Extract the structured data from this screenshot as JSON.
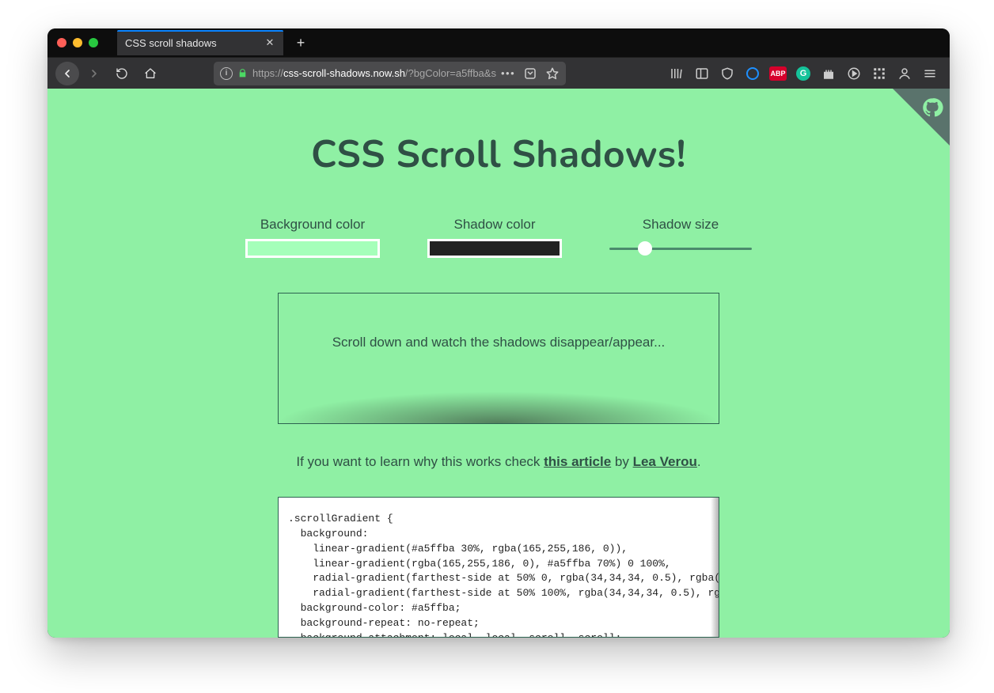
{
  "colors": {
    "page_bg": "#8ff0a4",
    "accent_text": "#2f5045",
    "bg_color_value": "#a5ffba",
    "shadow_color_value": "#222222"
  },
  "window": {
    "close": "",
    "minimize": "",
    "maximize": ""
  },
  "tab": {
    "title": "CSS scroll shadows",
    "close": "✕"
  },
  "toolbar": {
    "back": "Back",
    "forward": "Forward",
    "refresh": "Reload",
    "home": "Home",
    "new_tab_plus": "+",
    "abp": "ABP",
    "grammarly": "G",
    "menu": "Menu"
  },
  "address": {
    "info_icon": "i",
    "protocol": "https://",
    "host": "css-scroll-shadows.now.sh",
    "path": "/?bgColor=a5ffba&s",
    "dots": "•••"
  },
  "page": {
    "title": "CSS Scroll Shadows!",
    "controls": {
      "bg_label": "Background color",
      "shadow_label": "Shadow color",
      "size_label": "Shadow size",
      "size_value": 25,
      "size_min": 0,
      "size_max": 100
    },
    "demo_text": "Scroll down and watch the shadows disappear/appear...",
    "explain_pre": "If you want to learn why this works check ",
    "explain_link1": "this article",
    "explain_mid": " by ",
    "explain_link2": "Lea Verou",
    "explain_post": ".",
    "code": ".scrollGradient {\n  background:\n    linear-gradient(#a5ffba 30%, rgba(165,255,186, 0)),\n    linear-gradient(rgba(165,255,186, 0), #a5ffba 70%) 0 100%,\n    radial-gradient(farthest-side at 50% 0, rgba(34,34,34, 0.5), rgba(\n    radial-gradient(farthest-side at 50% 100%, rgba(34,34,34, 0.5), rg\n  background-color: #a5ffba;\n  background-repeat: no-repeat;\n  background-attachment: local, local, scroll, scroll;"
  }
}
